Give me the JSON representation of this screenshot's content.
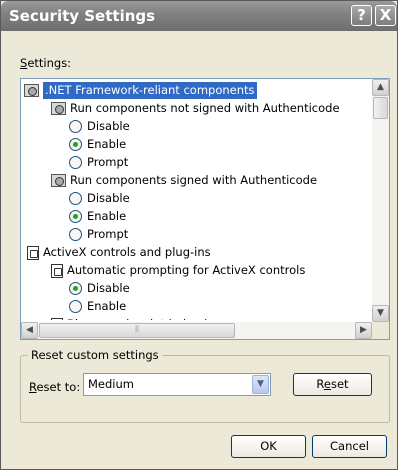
{
  "window": {
    "title": "Security Settings"
  },
  "titlebar": {
    "help_glyph": "?",
    "close_glyph": "X"
  },
  "settings": {
    "label_accel": "S",
    "label_rest": "ettings:"
  },
  "tree": {
    "rows": [
      {
        "text": ".NET Framework-reliant components",
        "kind": "gear",
        "checked": false,
        "highlighted": true
      },
      {
        "text": "Run components not signed with Authenticode",
        "kind": "gear",
        "checked": false,
        "highlighted": false
      },
      {
        "text": "Disable",
        "kind": "radio",
        "checked": false,
        "highlighted": false
      },
      {
        "text": "Enable",
        "kind": "radio",
        "checked": true,
        "highlighted": false
      },
      {
        "text": "Prompt",
        "kind": "radio",
        "checked": false,
        "highlighted": false
      },
      {
        "text": "Run components signed with Authenticode",
        "kind": "gear",
        "checked": false,
        "highlighted": false
      },
      {
        "text": "Disable",
        "kind": "radio",
        "checked": false,
        "highlighted": false
      },
      {
        "text": "Enable",
        "kind": "radio",
        "checked": true,
        "highlighted": false
      },
      {
        "text": "Prompt",
        "kind": "radio",
        "checked": false,
        "highlighted": false
      },
      {
        "text": "ActiveX controls and plug-ins",
        "kind": "page",
        "checked": false,
        "highlighted": false
      },
      {
        "text": "Automatic prompting for ActiveX controls",
        "kind": "page",
        "checked": false,
        "highlighted": false
      },
      {
        "text": "Disable",
        "kind": "radio",
        "checked": true,
        "highlighted": false
      },
      {
        "text": "Enable",
        "kind": "radio",
        "checked": false,
        "highlighted": false
      },
      {
        "text": "Binary and script behaviors",
        "kind": "page",
        "checked": false,
        "highlighted": false
      }
    ]
  },
  "reset_group": {
    "title": "Reset custom settings",
    "label_accel": "R",
    "label_rest": "eset to:",
    "selected_value": "Medium",
    "reset_pre": "R",
    "reset_accel": "e",
    "reset_post": "set"
  },
  "footer": {
    "ok_label": "OK",
    "cancel_label": "Cancel"
  }
}
